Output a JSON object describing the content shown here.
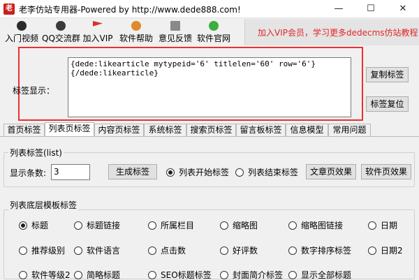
{
  "window": {
    "title": "老李仿站专用器-Powered by http://www.dede888.com!",
    "icon": "老",
    "controls": [
      "—",
      "☐",
      "✕"
    ]
  },
  "toolbar": {
    "items": [
      {
        "label": "入门视频",
        "icon": "video-icon"
      },
      {
        "label": "QQ交流群",
        "icon": "qq-group-icon"
      },
      {
        "label": "加入VIP",
        "icon": "vip-flag-icon"
      },
      {
        "label": "软件帮助",
        "icon": "help-icon"
      },
      {
        "label": "意见反馈",
        "icon": "feedback-icon"
      },
      {
        "label": "软件官网",
        "icon": "website-icon"
      }
    ],
    "promo": "加入VIP会员，学习更多dedecms仿站教程"
  },
  "tag_panel": {
    "label": "标签显示：",
    "code": "{dede:likearticle mytypeid='6' titlelen='60' row='6'}\n{/dede:likearticle}",
    "copy_button": "复制标签",
    "reset_button": "标签复位"
  },
  "tabs": [
    "首页标签",
    "列表页标签",
    "内容页标签",
    "系统标签",
    "搜索页标签",
    "留言板标签",
    "信息模型",
    "常用问题"
  ],
  "list_tag_group": {
    "title": "列表标签(list)",
    "count_label": "显示条数:",
    "count_value": "3",
    "generate_button": "生成标签",
    "radio_start": "列表开始标签",
    "radio_end": "列表结束标签",
    "article_effect_button": "文章页效果",
    "software_effect_button": "软件页效果"
  },
  "bottom_group": {
    "title": "列表底层模板标签",
    "options": [
      "标题",
      "标题链接",
      "所属栏目",
      "缩略图",
      "缩略图链接",
      "日期",
      "推荐级别",
      "软件语言",
      "点击数",
      "好评数",
      "数字排序标签",
      "日期2",
      "软件等级2",
      "简略标题",
      "SEO标题标签",
      "封面简介标签",
      "显示全部标题"
    ],
    "selected": "标题"
  },
  "colors": {
    "accent_red": "#e8312f",
    "promo_text": "#e32626"
  }
}
